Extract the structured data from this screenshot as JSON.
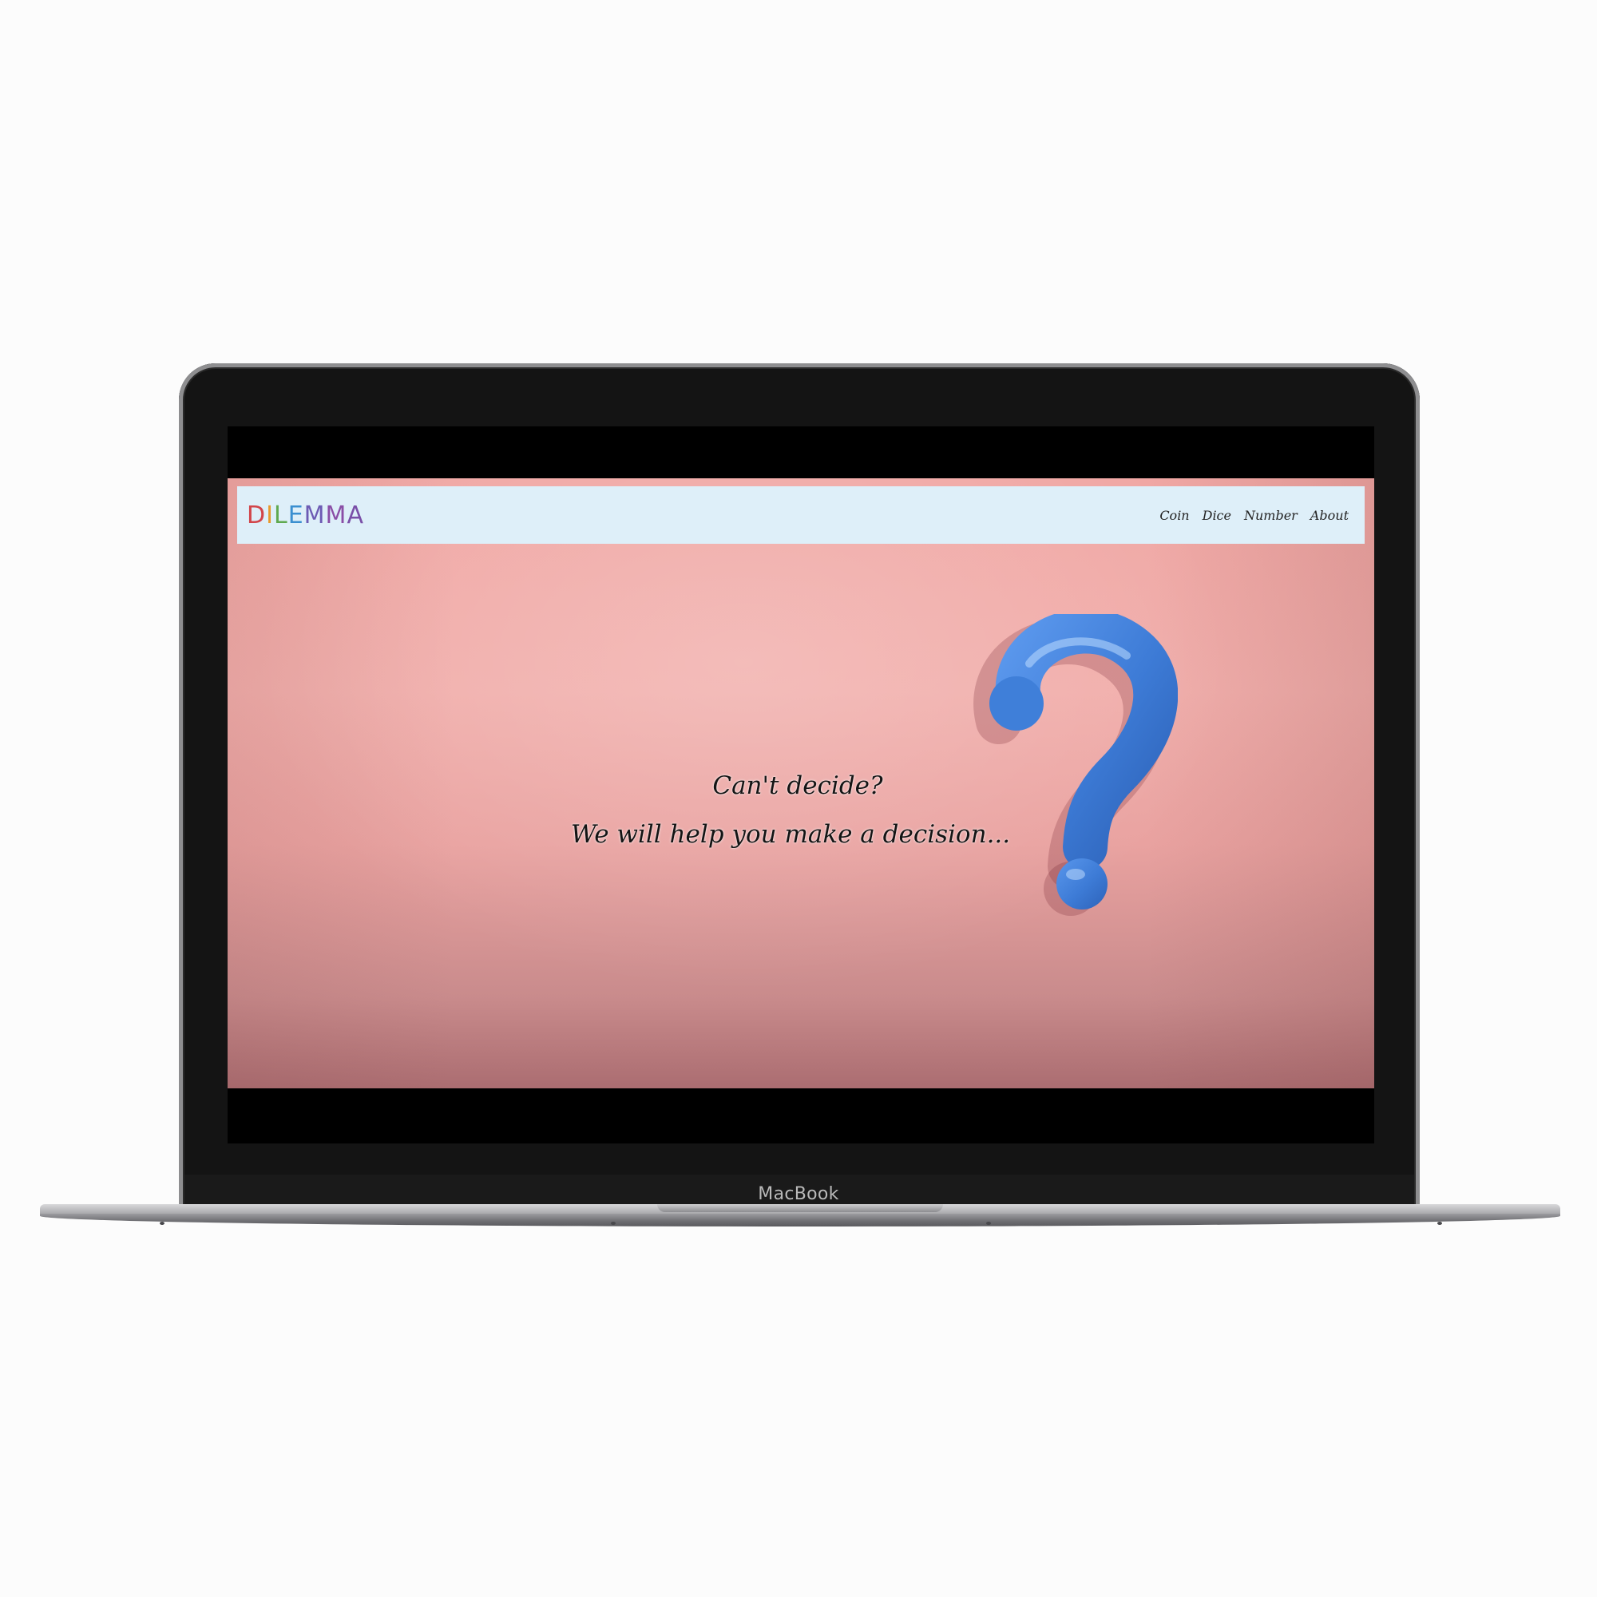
{
  "device": {
    "brand_label": "MacBook"
  },
  "site": {
    "logo": {
      "letters": [
        {
          "char": "D",
          "color": "#d2454a"
        },
        {
          "char": "I",
          "color": "#e89a2e"
        },
        {
          "char": "L",
          "color": "#5fa94f"
        },
        {
          "char": "E",
          "color": "#3a8fd0"
        },
        {
          "char": "M",
          "color": "#6c5bb4"
        },
        {
          "char": "M",
          "color": "#8a4ea6"
        },
        {
          "char": "A",
          "color": "#7a4fa8"
        }
      ]
    },
    "nav": {
      "items": [
        {
          "label": "Coin"
        },
        {
          "label": "Dice"
        },
        {
          "label": "Number"
        },
        {
          "label": "About"
        }
      ]
    },
    "hero": {
      "line1": "Can't decide?",
      "line2": "We will help you make a decision...",
      "image_icon": "question-mark-icon",
      "accent_color": "#3d7bd6",
      "background_color": "#f0a7a4"
    }
  }
}
